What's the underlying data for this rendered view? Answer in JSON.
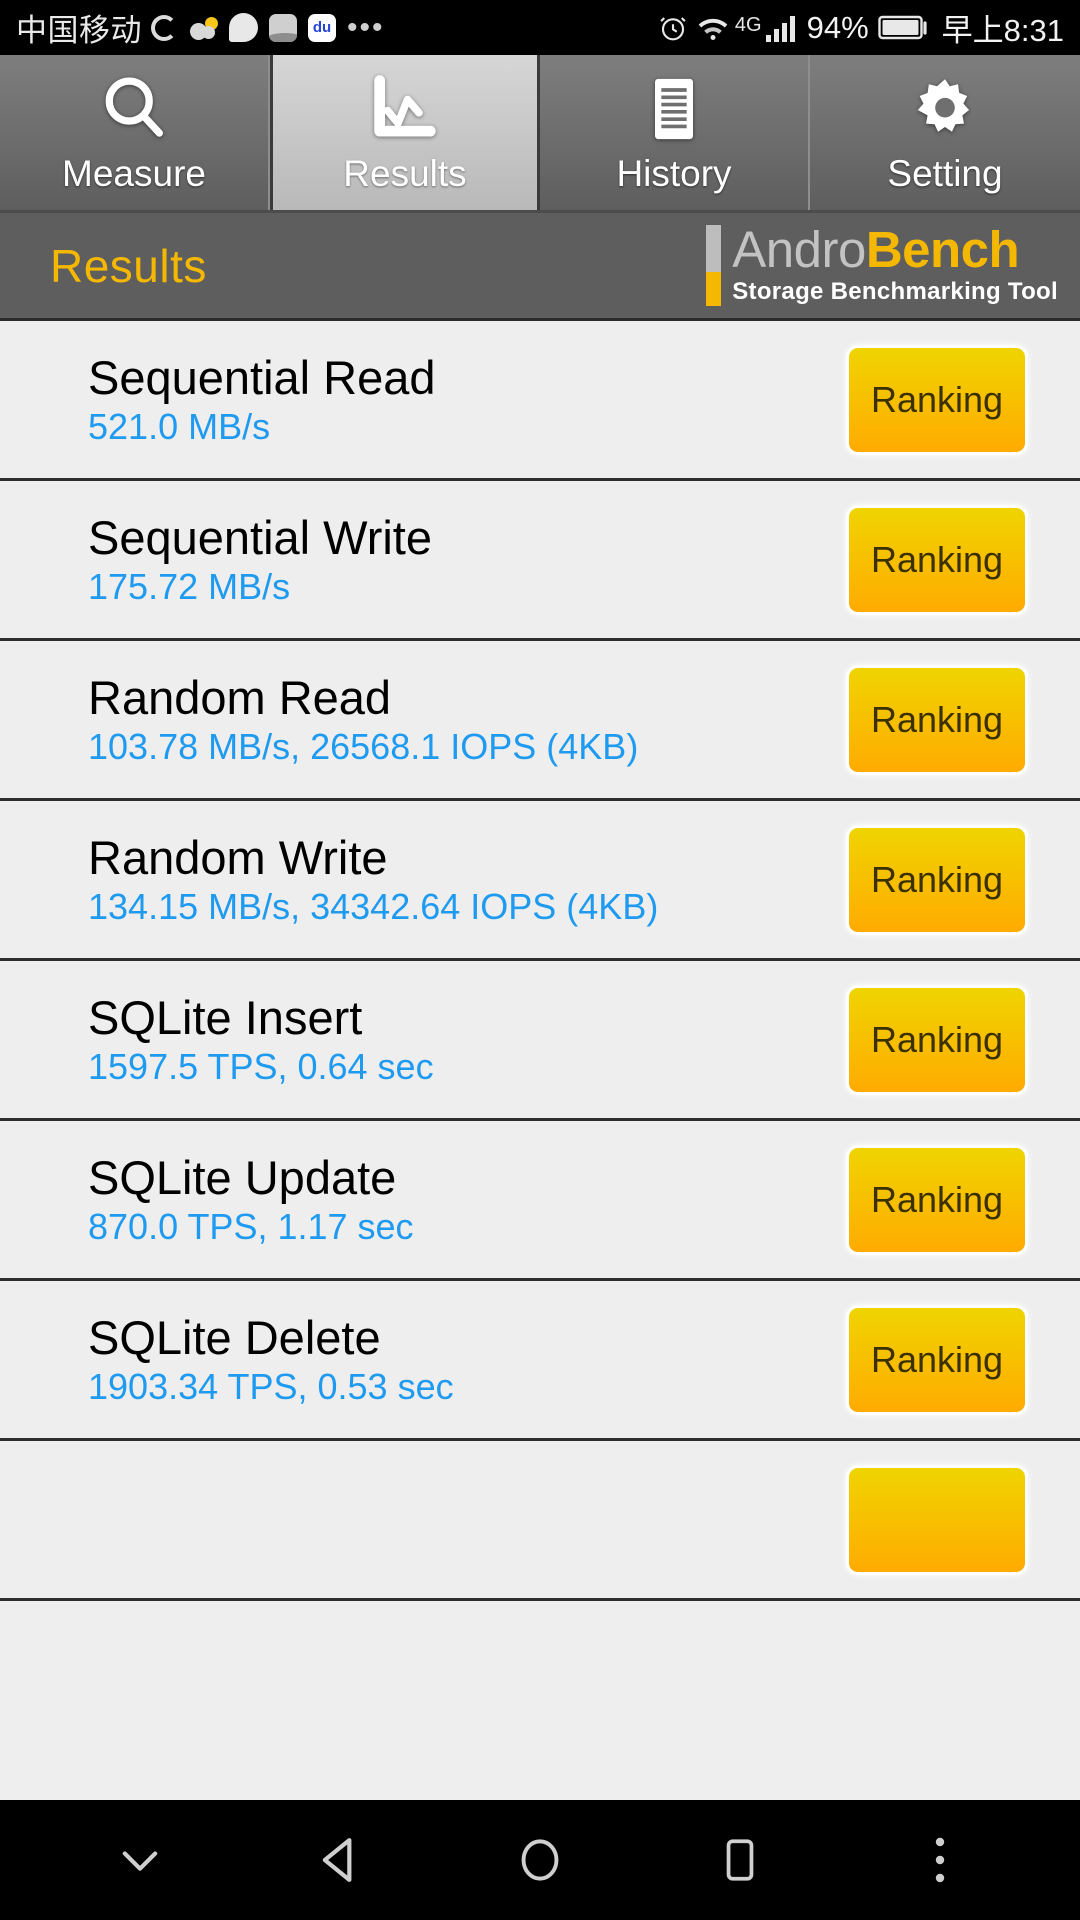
{
  "status_bar": {
    "carrier": "中国移动",
    "icons": [
      "loading-ring-icon",
      "weather-cloud-icon",
      "qq-browser-icon",
      "taobao-icon",
      "baidu-icon",
      "more-dots-icon",
      "alarm-icon",
      "wifi-icon",
      "network-4g-icon",
      "signal-bars-icon",
      "battery-icon"
    ],
    "network_type": "4G",
    "battery_percent": "94%",
    "time": "早上8:31",
    "more": "•••",
    "baidu_label": "du"
  },
  "tabs": [
    {
      "label": "Measure",
      "icon": "magnifier-icon",
      "active": false
    },
    {
      "label": "Results",
      "icon": "chart-icon",
      "active": true
    },
    {
      "label": "History",
      "icon": "list-icon",
      "active": false
    },
    {
      "label": "Setting",
      "icon": "gear-icon",
      "active": false
    }
  ],
  "header": {
    "page_title": "Results",
    "logo_andro": "Andro",
    "logo_bench": "Bench",
    "logo_subtitle": "Storage Benchmarking Tool"
  },
  "colors": {
    "accent_yellow": "#f5b800",
    "value_blue": "#1e9bf0",
    "list_bg": "#eeeeee",
    "header_bg": "#5e5e5e"
  },
  "results": [
    {
      "title": "Sequential Read",
      "value": "521.0 MB/s",
      "button": "Ranking"
    },
    {
      "title": "Sequential Write",
      "value": "175.72 MB/s",
      "button": "Ranking"
    },
    {
      "title": "Random Read",
      "value": "103.78 MB/s, 26568.1 IOPS (4KB)",
      "button": "Ranking"
    },
    {
      "title": "Random Write",
      "value": "134.15 MB/s, 34342.64 IOPS (4KB)",
      "button": "Ranking"
    },
    {
      "title": "SQLite Insert",
      "value": "1597.5 TPS, 0.64 sec",
      "button": "Ranking"
    },
    {
      "title": "SQLite Update",
      "value": "870.0 TPS, 1.17 sec",
      "button": "Ranking"
    },
    {
      "title": "SQLite Delete",
      "value": "1903.34 TPS, 0.53 sec",
      "button": "Ranking"
    }
  ],
  "nav_bar": {
    "buttons": [
      "hide-keyboard-icon",
      "back-icon",
      "home-icon",
      "recents-icon",
      "overflow-menu-icon"
    ]
  }
}
